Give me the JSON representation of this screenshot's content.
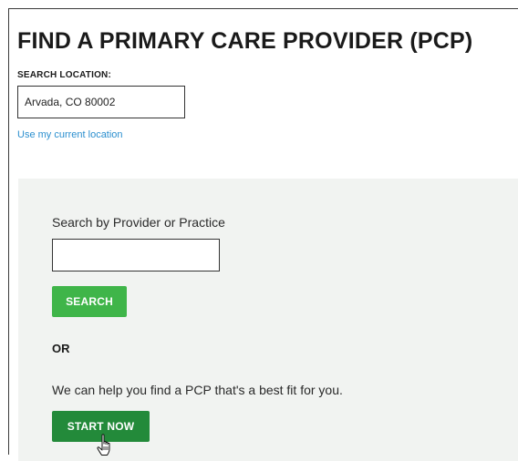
{
  "page": {
    "title": "FIND A PRIMARY CARE PROVIDER (PCP)"
  },
  "location": {
    "label": "SEARCH LOCATION:",
    "value": "Arvada, CO 80002",
    "use_current_link": "Use my current location"
  },
  "provider_search": {
    "label": "Search by Provider or Practice",
    "value": "",
    "search_button": "SEARCH"
  },
  "alternative": {
    "or_text": "OR",
    "help_text": "We can help you find a PCP that's a best fit for you.",
    "start_button": "START NOW"
  },
  "colors": {
    "search_button": "#3fb549",
    "start_button": "#238a3a",
    "link": "#2b8fcf",
    "panel_background": "#f1f3f1"
  },
  "icons": {
    "cursor": "hand-pointer-icon"
  }
}
